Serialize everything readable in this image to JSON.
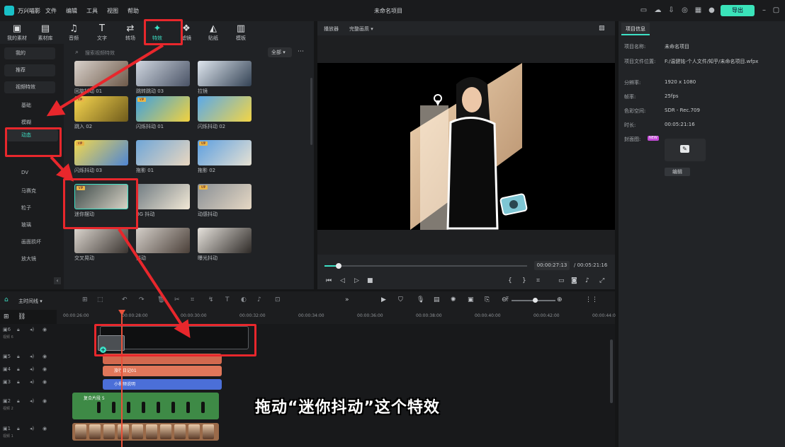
{
  "app": {
    "name": "万兴喵影",
    "window_title": "未命名项目",
    "export_label": "导出"
  },
  "menu": [
    "文件",
    "编辑",
    "工具",
    "视图",
    "帮助"
  ],
  "toolbar": [
    "我的素材",
    "素材库",
    "音频",
    "文字",
    "转场",
    "特效",
    "滤镜",
    "贴纸",
    "模板"
  ],
  "sidebar": {
    "categories": [
      "我的",
      "推荐",
      "视频特效"
    ],
    "subcategories": [
      "基础",
      "模糊",
      "动态",
      "",
      "DV",
      "马赛克",
      "粒子",
      "玻璃",
      "画面损坏",
      "放大镜"
    ],
    "active": "动态"
  },
  "search": {
    "placeholder": "搜索视频特效",
    "filter": "全部"
  },
  "effects": [
    {
      "label": "回旋抖动 01",
      "vip": false
    },
    {
      "label": "跳转跳动 03",
      "vip": false
    },
    {
      "label": "拉镜",
      "vip": false
    },
    {
      "label": "跳入 02",
      "vip": true
    },
    {
      "label": "闪烁抖动 01",
      "vip": true
    },
    {
      "label": "闪烁抖动 02",
      "vip": false
    },
    {
      "label": "闪烁抖动 03",
      "vip": true
    },
    {
      "label": "拖影 01",
      "vip": false
    },
    {
      "label": "拖影 02",
      "vip": true
    },
    {
      "label": "迷你摆动",
      "vip": true
    },
    {
      "label": "BG 抖动",
      "vip": false
    },
    {
      "label": "动感抖动",
      "vip": true
    },
    {
      "label": "交叉晃动",
      "vip": false
    },
    {
      "label": "抖动",
      "vip": false
    },
    {
      "label": "曝光抖动",
      "vip": false
    }
  ],
  "player": {
    "label": "播放器",
    "quality": "完整画质",
    "current_time": "00:00:27:13",
    "total_time": "00:05:21:16",
    "progress": 0.07
  },
  "project_info": {
    "tab": "项目信息",
    "rows": [
      {
        "key": "项目名称:",
        "value": "未命名项目"
      },
      {
        "key": "项目文件位置:",
        "value": "F:/温健铭-个人文件/知乎/未命名项目.wfpx"
      },
      {
        "key": "分辨率:",
        "value": "1920 x 1080"
      },
      {
        "key": "帧率:",
        "value": "25fps"
      },
      {
        "key": "色彩空间:",
        "value": "SDR - Rec.709"
      },
      {
        "key": "时长:",
        "value": "00:05:21:16"
      }
    ],
    "cover_label": "封面图:",
    "cover_badge": "NEW",
    "edit_button": "编辑"
  },
  "timeline": {
    "label": "主时间线",
    "ruler": [
      "00:00:26:00",
      "00:00:28:00",
      "00:00:30:00",
      "00:00:32:00",
      "00:00:34:00",
      "00:00:36:00",
      "00:00:38:00",
      "00:00:40:00",
      "00:00:42:00",
      "00:00:44:0"
    ],
    "tracks": [
      {
        "num": "6",
        "name": "视频 6"
      },
      {
        "num": "5",
        "name": ""
      },
      {
        "num": "4",
        "name": ""
      },
      {
        "num": "3",
        "name": ""
      },
      {
        "num": "2",
        "name": "视频 2"
      },
      {
        "num": "1",
        "name": "视频 1"
      }
    ],
    "clips": {
      "text1": "旅行日记01",
      "text2": "小视频说明",
      "compound": "复合片段 5"
    }
  },
  "caption": "拖动“迷你抖动”这个特效",
  "colors": {
    "accent": "#3de1c6",
    "annotation": "#e8272c",
    "text_clip": "#e0775a",
    "title_clip": "#4b6fd8",
    "video_clip": "#3e8a46"
  }
}
